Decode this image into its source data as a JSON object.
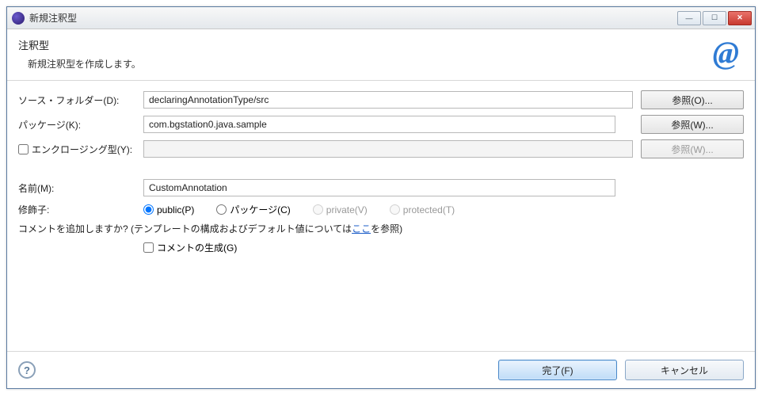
{
  "window": {
    "title": "新規注釈型"
  },
  "header": {
    "title": "注釈型",
    "description": "新規注釈型を作成します。"
  },
  "form": {
    "sourceFolder": {
      "label": "ソース・フォルダー(D):",
      "value": "declaringAnnotationType/src",
      "browse": "参照(O)..."
    },
    "package": {
      "label": "パッケージ(K):",
      "value": "com.bgstation0.java.sample",
      "browse": "参照(W)..."
    },
    "enclosing": {
      "label": "エンクロージング型(Y):",
      "value": "",
      "browse": "参照(W)..."
    },
    "name": {
      "label": "名前(M):",
      "value": "CustomAnnotation"
    },
    "modifiers": {
      "label": "修飾子:",
      "public": "public(P)",
      "package": "パッケージ(C)",
      "private": "private(V)",
      "protected": "protected(T)"
    },
    "comment": {
      "prefix": "コメントを追加しますか? (テンプレートの構成およびデフォルト値については",
      "link": "ここ",
      "suffix": "を参照)",
      "generate": "コメントの生成(G)"
    }
  },
  "footer": {
    "finish": "完了(F)",
    "cancel": "キャンセル"
  }
}
